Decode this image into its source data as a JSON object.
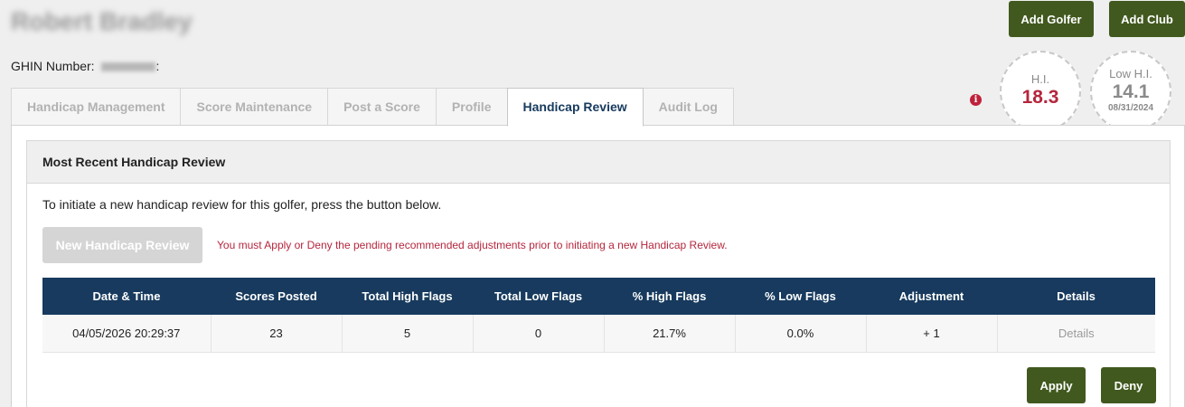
{
  "header": {
    "golfer_name": "Robert Bradley",
    "ghin_label": "GHIN Number:",
    "ghin_suffix": ":",
    "add_golfer_label": "Add Golfer",
    "add_club_label": "Add Club"
  },
  "stats": {
    "hi_label": "H.I.",
    "hi_value": "18.3",
    "low_hi_label": "Low H.I.",
    "low_hi_value": "14.1",
    "low_hi_date": "08/31/2024"
  },
  "tabs": [
    {
      "label": "Handicap Management",
      "active": false
    },
    {
      "label": "Score Maintenance",
      "active": false
    },
    {
      "label": "Post a Score",
      "active": false
    },
    {
      "label": "Profile",
      "active": false
    },
    {
      "label": "Handicap Review",
      "active": true
    },
    {
      "label": "Audit Log",
      "active": false
    }
  ],
  "review": {
    "title": "Most Recent Handicap Review",
    "intro": "To initiate a new handicap review for this golfer, press the button below.",
    "new_review_label": "New Handicap Review",
    "warning": "You must Apply or Deny the pending recommended adjustments prior to initiating a new Handicap Review.",
    "columns": [
      "Date & Time",
      "Scores Posted",
      "Total High Flags",
      "Total Low Flags",
      "% High Flags",
      "% Low Flags",
      "Adjustment",
      "Details"
    ],
    "rows": [
      [
        "04/05/2026 20:29:37",
        "23",
        "5",
        "0",
        "21.7%",
        "0.0%",
        "+ 1",
        "Details"
      ]
    ],
    "apply_label": "Apply",
    "deny_label": "Deny"
  },
  "colors": {
    "primary_green": "#41591e",
    "navy": "#173a5e",
    "alert_red": "#b4263d"
  },
  "icons": {
    "info": "info-icon"
  }
}
